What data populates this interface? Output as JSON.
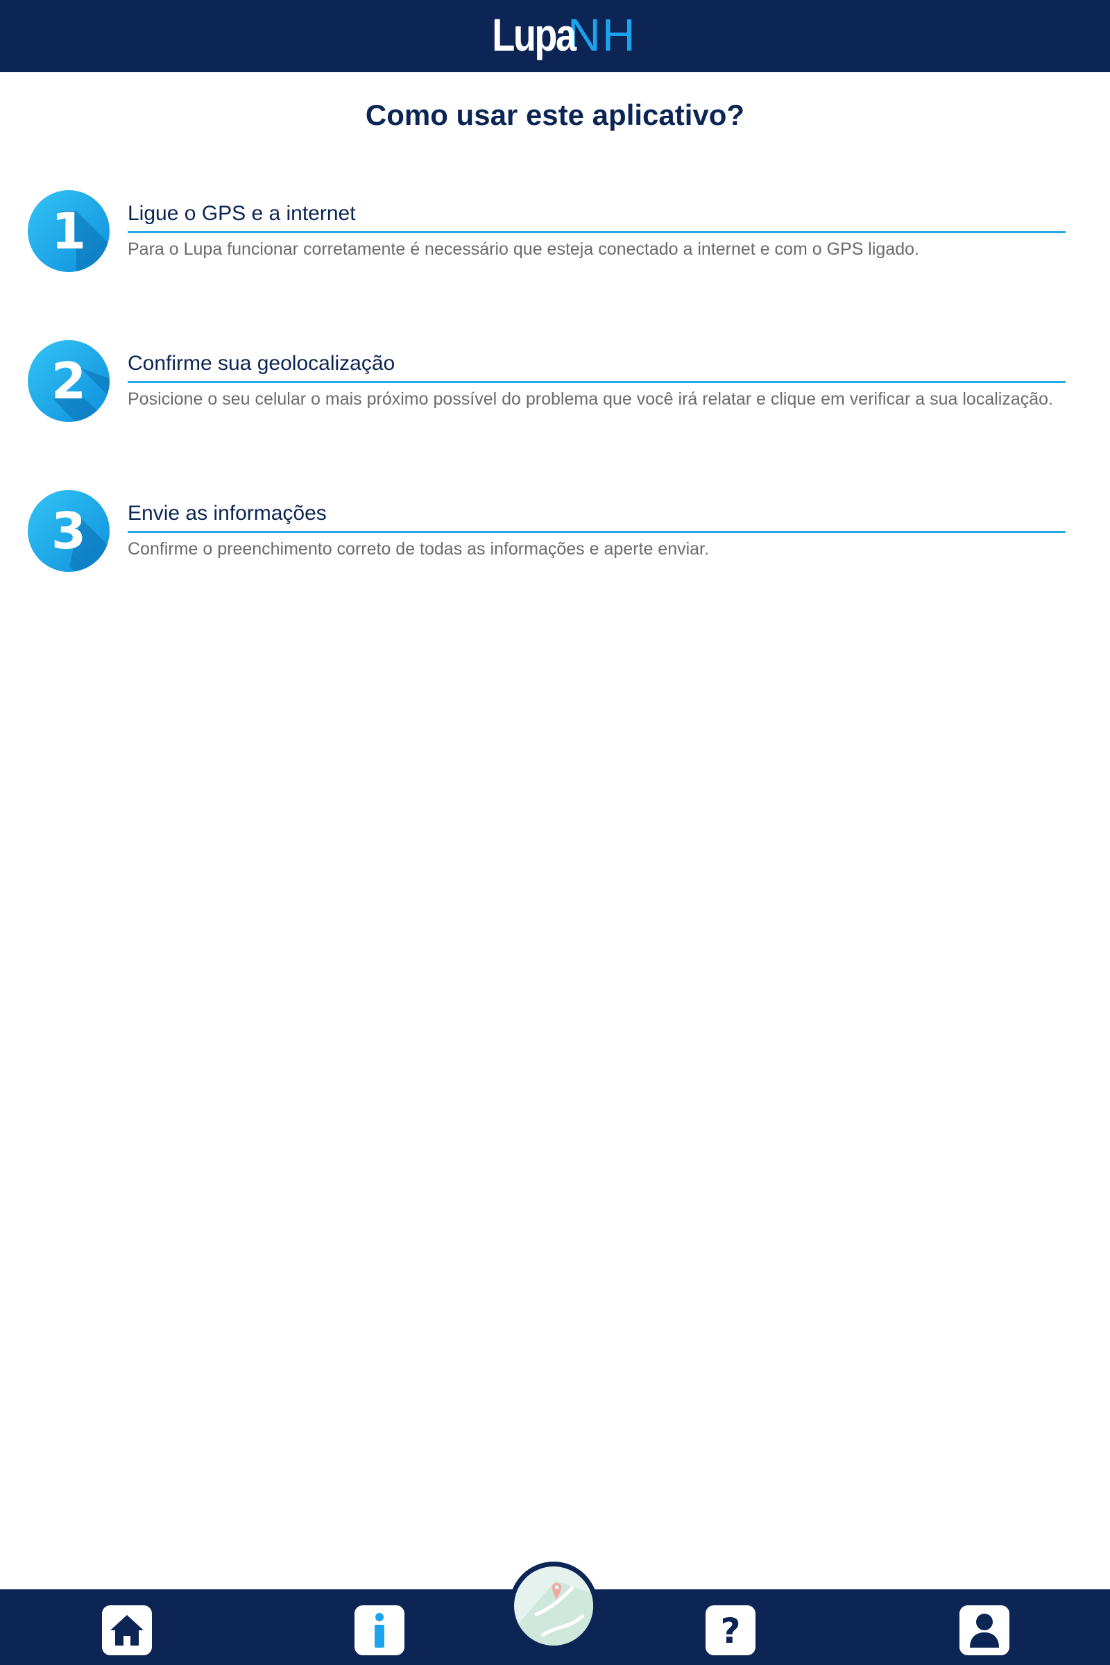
{
  "app": {
    "logo_part1": "Lupa",
    "logo_part2": "NH"
  },
  "page": {
    "title": "Como usar este aplicativo?"
  },
  "steps": [
    {
      "number": "1",
      "heading": "Ligue o GPS e a internet",
      "text": "Para o Lupa funcionar corretamente é necessário que esteja conectado a internet e com o GPS ligado."
    },
    {
      "number": "2",
      "heading": "Confirme sua geolocalização",
      "text": "Posicione o seu celular o mais próximo possível do problema que você irá relatar e clique em verificar a sua localização."
    },
    {
      "number": "3",
      "heading": "Envie as informações",
      "text": "Confirme o preenchimento correto de todas as informações e aperte enviar."
    }
  ],
  "bottom_nav": {
    "items": [
      {
        "icon": "home-icon"
      },
      {
        "icon": "info-icon"
      },
      {
        "icon": "map-icon"
      },
      {
        "icon": "help-icon"
      },
      {
        "icon": "user-icon"
      }
    ]
  },
  "colors": {
    "navy": "#0c2554",
    "accent_blue": "#1ba3ee",
    "rule_blue": "#27a8e6",
    "body_text": "#6b6b6b"
  }
}
